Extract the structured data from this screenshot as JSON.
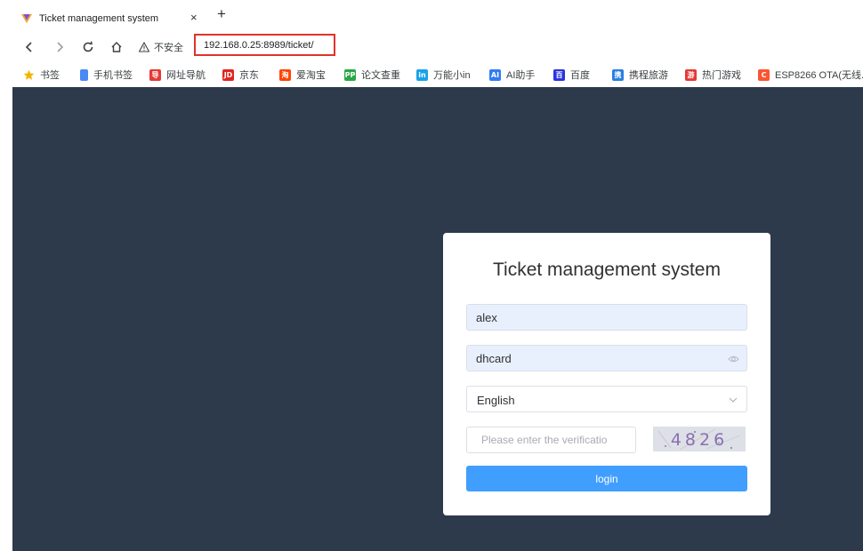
{
  "browser": {
    "tab": {
      "title": "Ticket management system",
      "close_glyph": "×"
    },
    "new_tab_glyph": "+",
    "security_label": "不安全",
    "url": "192.168.0.25:8989/ticket/"
  },
  "bookmarks": [
    {
      "label": "书签",
      "icon": "star-icon",
      "color": "#f4b400"
    },
    {
      "label": "手机书签",
      "icon": "phone-icon",
      "color": "#4a8af4"
    },
    {
      "label": "网址导航",
      "icon": "nav-icon",
      "color": "#e53935",
      "glyph": "导"
    },
    {
      "label": "京东",
      "icon": "jd-icon",
      "color": "#e1251b",
      "glyph": "JD"
    },
    {
      "label": "爱淘宝",
      "icon": "taobao-icon",
      "color": "#ff4400",
      "glyph": "淘"
    },
    {
      "label": "论文查重",
      "icon": "pp-icon",
      "color": "#29a745",
      "glyph": "PP"
    },
    {
      "label": "万能小in",
      "icon": "in-icon",
      "color": "#1aa3e8",
      "glyph": "in"
    },
    {
      "label": "AI助手",
      "icon": "ai-icon",
      "color": "#2f7cf6",
      "glyph": "AI"
    },
    {
      "label": "百度",
      "icon": "baidu-icon",
      "color": "#2932e1",
      "glyph": "百"
    },
    {
      "label": "携程旅游",
      "icon": "ctrip-icon",
      "color": "#2a7de1",
      "glyph": "携"
    },
    {
      "label": "热门游戏",
      "icon": "game-icon",
      "color": "#e53935",
      "glyph": "游"
    },
    {
      "label": "ESP8266 OTA(无线...",
      "icon": "csdn-icon",
      "color": "#fc5531",
      "glyph": "C"
    }
  ],
  "login": {
    "title": "Ticket management system",
    "username": "alex",
    "password": "dhcard",
    "language": "English",
    "captcha_placeholder": "Please enter the verificatio",
    "captcha_text": "4826",
    "login_label": "login"
  },
  "colors": {
    "page_background": "#2d3a4b",
    "primary": "#409eff",
    "url_highlight": "#e0322a",
    "autofill": "#e8f0fe"
  }
}
